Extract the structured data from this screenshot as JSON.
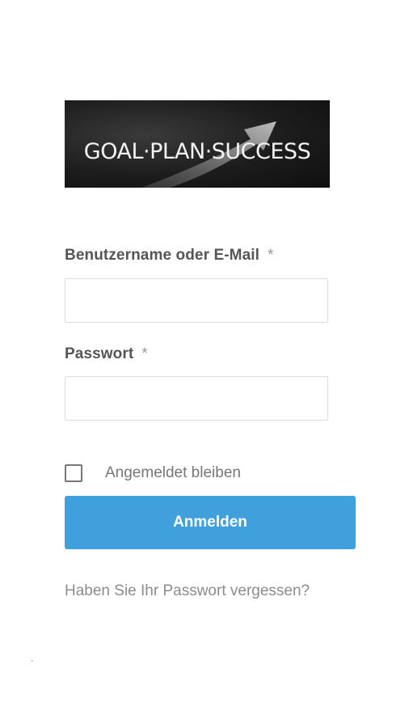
{
  "logo": {
    "text": "GOAL·PLAN·SUCCESS"
  },
  "form": {
    "username_label": "Benutzername oder E-Mail",
    "username_required": "*",
    "username_value": "",
    "password_label": "Passwort",
    "password_required": "*",
    "password_value": "",
    "remember_label": "Angemeldet bleiben",
    "remember_checked": false,
    "submit_label": "Anmelden",
    "forgot_link": "Haben Sie Ihr Passwort vergessen?"
  },
  "footer": {
    "mark": "-"
  },
  "colors": {
    "accent": "#3fa0dc",
    "label_text": "#555555",
    "muted_text": "#8c8c8c",
    "input_border": "#dddddd"
  }
}
